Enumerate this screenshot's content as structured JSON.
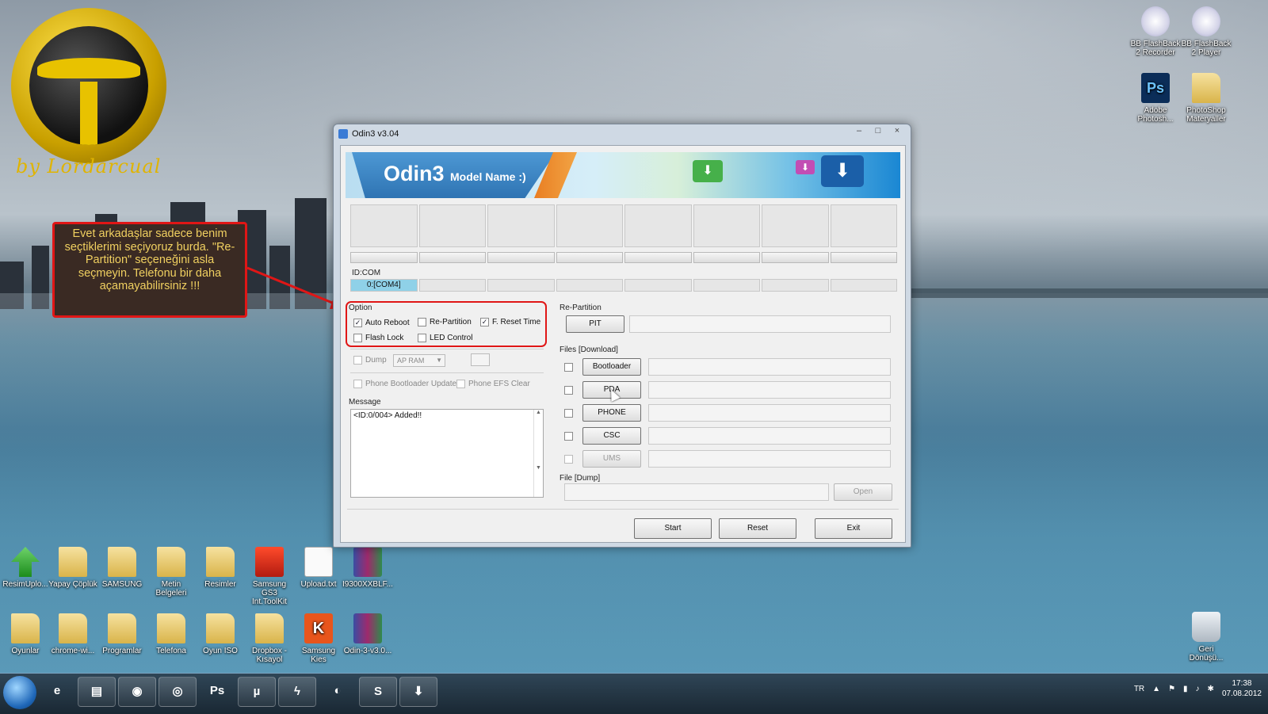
{
  "window": {
    "title": "Odin3 v3.04",
    "minimize": "–",
    "maximize": "□",
    "close": "×"
  },
  "banner": {
    "title": "Odin3",
    "subtitle": "Model Name :)"
  },
  "id_com": {
    "label": "ID:COM",
    "ports": [
      "0:[COM4]",
      "",
      "",
      "",
      "",
      "",
      "",
      ""
    ]
  },
  "options": {
    "label": "Option",
    "auto_reboot": {
      "label": "Auto Reboot",
      "checked": true
    },
    "re_partition": {
      "label": "Re-Partition",
      "checked": false
    },
    "f_reset_time": {
      "label": "F. Reset Time",
      "checked": true
    },
    "flash_lock": {
      "label": "Flash Lock",
      "checked": false
    },
    "led_control": {
      "label": "LED Control",
      "checked": false
    },
    "dump": {
      "label": "Dump",
      "checked": false
    },
    "dump_select": "AP RAM",
    "phone_bootloader_update": {
      "label": "Phone Bootloader Update",
      "checked": false
    },
    "phone_efs_clear": {
      "label": "Phone EFS Clear",
      "checked": false
    }
  },
  "message": {
    "label": "Message",
    "text": "<ID:0/004> Added!!"
  },
  "repartition": {
    "label": "Re-Partition",
    "pit_button": "PIT"
  },
  "files_download": {
    "label": "Files [Download]",
    "buttons": [
      "Bootloader",
      "PDA",
      "PHONE",
      "CSC",
      "UMS"
    ]
  },
  "file_dump": {
    "label": "File [Dump]",
    "open_button": "Open"
  },
  "actions": {
    "start": "Start",
    "reset": "Reset",
    "exit": "Exit"
  },
  "annotation": {
    "text": "Evet arkadaşlar sadece benim seçtiklerimi seçiyoruz burda. \"Re-Partition\" seçeneğini asla seçmeyin. Telefonu bir daha açamayabilirsiniz !!!",
    "color": "#e01616"
  },
  "logo": {
    "signature": "by Lordarcual"
  },
  "desktop_icons_row1": [
    "ResimUplo...",
    "Yapay Çöplük",
    "SAMSUNG",
    "Metin Belgeleri",
    "Resimler",
    "Samsung GS3 Int.ToolKit",
    "Upload.txt",
    "I9300XXBLF..."
  ],
  "desktop_icons_row2": [
    "Oyunlar",
    "chrome-wi...",
    "Programlar",
    "Telefona",
    "Oyun ISO",
    "Dropbox - Kısayol",
    "Samsung Kies",
    "Odin-3-v3.0..."
  ],
  "desktop_icons_right": [
    "BB FlashBack 2 Recorder",
    "BB FlashBack 2 Player",
    "Adobe Photosh...",
    "PhotoShop Materyaller",
    "Geri Dönüşü..."
  ],
  "taskbar": {
    "language": "TR",
    "time": "17:38",
    "date": "07.08.2012"
  }
}
